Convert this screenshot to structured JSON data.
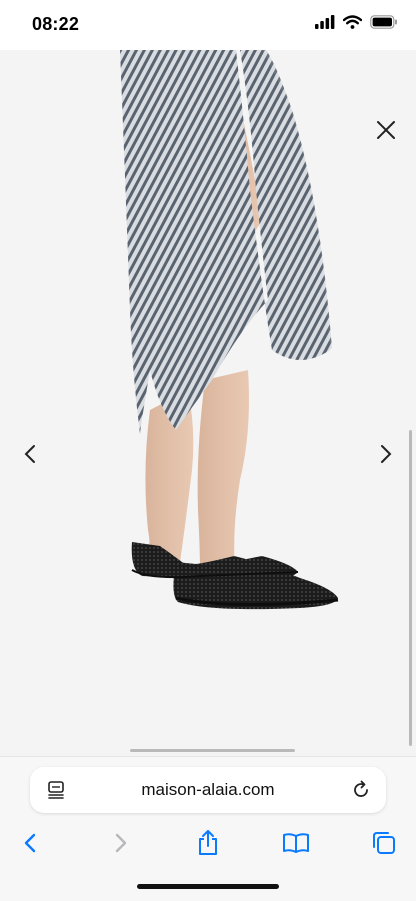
{
  "status_bar": {
    "time": "08:22"
  },
  "browser": {
    "url": "maison-alaia.com"
  },
  "icons": {
    "signal": "cellular-signal-icon",
    "wifi": "wifi-icon",
    "battery": "battery-icon",
    "close": "close-icon",
    "prev": "chevron-left-icon",
    "next": "chevron-right-icon",
    "reader": "reader-mode-icon",
    "reload": "reload-icon",
    "back": "back-arrow-icon",
    "forward": "forward-arrow-icon",
    "share": "share-icon",
    "bookmarks": "bookmarks-icon",
    "tabs": "tabs-icon"
  },
  "colors": {
    "accent": "#0a7aff",
    "background": "#f4f4f4"
  }
}
